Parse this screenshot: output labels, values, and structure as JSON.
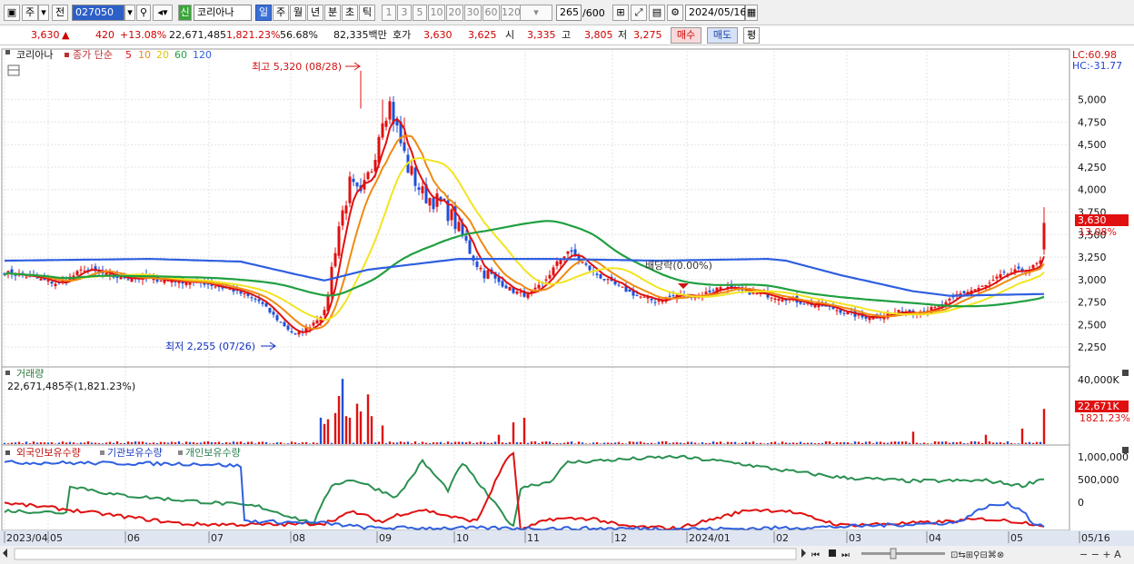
{
  "toolbar": {
    "period_type": "주",
    "prev_label": "전",
    "code": "027050",
    "badge": "신",
    "name": "코리아나",
    "timeframes": [
      "일",
      "주",
      "월",
      "년",
      "분",
      "초",
      "틱"
    ],
    "active_timeframe": "일",
    "intervals": [
      "1",
      "3",
      "5",
      "10",
      "20",
      "30",
      "60",
      "120"
    ],
    "count": "265",
    "count_total": "/600",
    "date": "2024/05/16"
  },
  "quote": {
    "price": "3,630",
    "change": "420",
    "change_pct": "+13.08%",
    "volume": "22,671,485",
    "volume_ratio": "1,821.23%",
    "rate": "56.68%",
    "amount": "82,335백만",
    "ask_label": "호가",
    "ask1": "3,630",
    "ask2": "3,625",
    "open_label": "시",
    "open": "3,335",
    "high_label": "고",
    "high": "3,805",
    "low_label": "저",
    "low": "3,275",
    "buy_label": "매수",
    "sell_label": "매도",
    "eval_label": "평"
  },
  "price_panel": {
    "name": "코리아나",
    "ma_label": "종가 단순",
    "ma_periods": [
      "5",
      "10",
      "20",
      "60",
      "120"
    ],
    "ma_colors": [
      "#e01010",
      "#f08a10",
      "#f2e420",
      "#20a040",
      "#2f5fe0"
    ],
    "max_label": "최고 5,320 (08/28)",
    "min_label": "최저 2,255 (07/26)",
    "dividend_label": "배당락(0.00%)",
    "lc": "LC:60.98",
    "hc": "HC:-31.77",
    "last_price": "3,630",
    "last_pct": "13.08%",
    "ylim": [
      2050,
      5400
    ],
    "yticks": [
      "5,000",
      "4,750",
      "4,500",
      "4,250",
      "4,000",
      "3,750",
      "3,500",
      "3,250",
      "3,000",
      "2,750",
      "2,500",
      "2,250"
    ]
  },
  "volume_panel": {
    "title": "거래량",
    "value": "22,671,485주(1,821.23%)",
    "ytick": "40,000K",
    "last": "22,671K",
    "last_pct": "1821.23%"
  },
  "holding_panel": {
    "legend": [
      "외국인보유수량",
      "기관보유수량",
      "개인보유수량"
    ],
    "colors": [
      "#e01010",
      "#2f5fe0",
      "#2a9050"
    ],
    "yticks": [
      "1,000,000",
      "500,000",
      "0"
    ]
  },
  "xaxis": {
    "labels": [
      "2023/04",
      "05",
      "06",
      "07",
      "08",
      "09",
      "10",
      "11",
      "12",
      "2024/01",
      "02",
      "03",
      "04",
      "05",
      "05/16"
    ]
  },
  "colors": {
    "up": "#e01010",
    "down": "#1e4fd8",
    "grid": "#d8d8d8"
  },
  "chart_data": {
    "type": "candlestick",
    "title": "코리아나",
    "price_anchors": [
      [
        0,
        3080
      ],
      [
        8,
        3020
      ],
      [
        15,
        2950
      ],
      [
        22,
        3120
      ],
      [
        30,
        3030
      ],
      [
        40,
        3010
      ],
      [
        55,
        2960
      ],
      [
        63,
        2880
      ],
      [
        70,
        2760
      ],
      [
        75,
        2560
      ],
      [
        80,
        2380
      ],
      [
        83,
        2450
      ],
      [
        88,
        2640
      ],
      [
        92,
        3600
      ],
      [
        95,
        4050
      ],
      [
        98,
        3900
      ],
      [
        101,
        4250
      ],
      [
        104,
        4850
      ],
      [
        106,
        4950
      ],
      [
        108,
        4650
      ],
      [
        111,
        4250
      ],
      [
        115,
        3950
      ],
      [
        120,
        3850
      ],
      [
        123,
        3700
      ],
      [
        127,
        3400
      ],
      [
        131,
        3120
      ],
      [
        135,
        3000
      ],
      [
        140,
        2870
      ],
      [
        144,
        2820
      ],
      [
        148,
        2950
      ],
      [
        152,
        3180
      ],
      [
        155,
        3320
      ],
      [
        158,
        3220
      ],
      [
        162,
        3080
      ],
      [
        166,
        2980
      ],
      [
        170,
        2900
      ],
      [
        174,
        2820
      ],
      [
        179,
        2760
      ],
      [
        185,
        2830
      ],
      [
        191,
        2820
      ],
      [
        197,
        2920
      ],
      [
        203,
        2870
      ],
      [
        209,
        2830
      ],
      [
        214,
        2800
      ],
      [
        220,
        2740
      ],
      [
        226,
        2700
      ],
      [
        231,
        2640
      ],
      [
        236,
        2580
      ],
      [
        241,
        2600
      ],
      [
        246,
        2640
      ],
      [
        252,
        2650
      ],
      [
        258,
        2700
      ],
      [
        262,
        2830
      ],
      [
        266,
        2880
      ],
      [
        270,
        2930
      ],
      [
        274,
        3040
      ],
      [
        278,
        3090
      ],
      [
        282,
        3110
      ],
      [
        285,
        3200
      ],
      [
        286,
        3630
      ]
    ],
    "ma_last": {
      "5": 3150,
      "10": 3120,
      "20": 3060,
      "60": 2820,
      "120": 2840
    },
    "ma120_anchors": [
      [
        0,
        3210
      ],
      [
        40,
        3230
      ],
      [
        65,
        3200
      ],
      [
        80,
        3060
      ],
      [
        88,
        2990
      ],
      [
        100,
        3110
      ],
      [
        125,
        3230
      ],
      [
        150,
        3230
      ],
      [
        180,
        3210
      ],
      [
        210,
        3230
      ],
      [
        215,
        3210
      ],
      [
        230,
        3050
      ],
      [
        250,
        2870
      ],
      [
        260,
        2820
      ],
      [
        286,
        2840
      ]
    ],
    "volume": {
      "ylim": [
        0,
        45000
      ],
      "spikes": [
        [
          87,
          17000
        ],
        [
          88,
          13000
        ],
        [
          89,
          16000
        ],
        [
          91,
          20000
        ],
        [
          92,
          31000
        ],
        [
          93,
          42000
        ],
        [
          94,
          18000
        ],
        [
          95,
          17000
        ],
        [
          97,
          26000
        ],
        [
          98,
          21000
        ],
        [
          100,
          32000
        ],
        [
          101,
          18000
        ],
        [
          104,
          12000
        ],
        [
          136,
          6000
        ],
        [
          140,
          14000
        ],
        [
          143,
          17000
        ],
        [
          250,
          8000
        ],
        [
          270,
          6000
        ],
        [
          280,
          10000
        ],
        [
          286,
          22671
        ]
      ]
    },
    "holdings": {
      "ylim": [
        -480000,
        1130000
      ]
    }
  }
}
